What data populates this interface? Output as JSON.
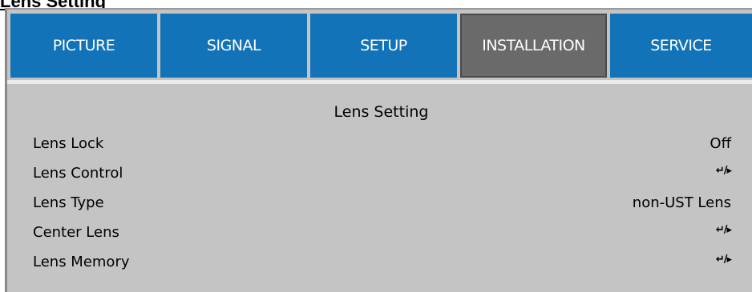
{
  "doc_heading": "Lens Setting",
  "tabs": [
    {
      "label": "PICTURE",
      "active": false
    },
    {
      "label": "SIGNAL",
      "active": false
    },
    {
      "label": "SETUP",
      "active": false
    },
    {
      "label": "INSTALLATION",
      "active": true
    },
    {
      "label": "SERVICE",
      "active": false
    }
  ],
  "panel": {
    "title": "Lens Setting",
    "rows": [
      {
        "label": "Lens Lock",
        "value": "Off"
      },
      {
        "label": "Lens Control",
        "value": "↵/▸"
      },
      {
        "label": "Lens Type",
        "value": "non-UST Lens"
      },
      {
        "label": "Center Lens",
        "value": "↵/▸"
      },
      {
        "label": "Lens Memory",
        "value": "↵/▸"
      }
    ]
  },
  "colors": {
    "tab": "#1273b8",
    "tab_active": "#6a6a6a",
    "panel_bg": "#c4c4c4"
  }
}
